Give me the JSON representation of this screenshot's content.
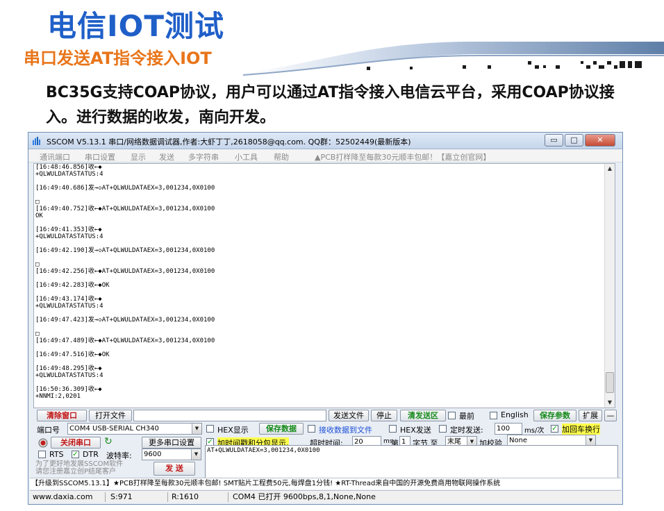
{
  "slide": {
    "title": "电信IOT测试",
    "subtitle": "串口发送AT指令接入IOT",
    "body": "BC35G支持COAP协议，用户可以通过AT指令接入电信云平台，采用COAP协议接入。进行数据的收发，南向开发。"
  },
  "window": {
    "title": "SSCOM V5.13.1 串口/网络数据调试器,作者:大虾丁丁,2618058@qq.com. QQ群：52502449(最新版本)",
    "controls": {
      "minimize": "▭",
      "maximize": "□",
      "close": "✕"
    }
  },
  "menu": {
    "items": [
      "通讯端口",
      "串口设置",
      "显示",
      "发送",
      "多字符串",
      "小工具",
      "帮助"
    ],
    "ad": "▲PCB打样降至每款30元顺丰包邮！【嘉立创官网】"
  },
  "log": {
    "lines": [
      "[16:48:46.856]收←◆",
      "+QLWULDATASTATUS:4",
      "",
      "[16:49:40.686]发→◇AT+QLWULDATAEX=3,001234,0X0100",
      "",
      "□",
      "[16:49:40.752]收←◆AT+QLWULDATAEX=3,001234,0X0100",
      "OK",
      "",
      "[16:49:41.353]收←◆",
      "+QLWULDATASTATUS:4",
      "",
      "[16:49:42.190]发→◇AT+QLWULDATAEX=3,001234,0X0100",
      "",
      "□",
      "[16:49:42.256]收←◆AT+QLWULDATAEX=3,001234,0X0100",
      "",
      "[16:49:42.283]收←◆OK",
      "",
      "[16:49:43.174]收←◆",
      "+QLWULDATASTATUS:4",
      "",
      "[16:49:47.423]发→◇AT+QLWULDATAEX=3,001234,0X0100",
      "",
      "□",
      "[16:49:47.489]收←◆AT+QLWULDATAEX=3,001234,0X0100",
      "",
      "[16:49:47.516]收←◆OK",
      "",
      "[16:49:48.295]收←◆",
      "+QLWULDATASTATUS:4",
      "",
      "[16:50:36.309]收←◆",
      "+NNMI:2,0201"
    ]
  },
  "toolbar": {
    "clear_window": "清除窗口",
    "open_file": "打开文件",
    "send_file": "发送文件",
    "stop": "停止",
    "clear_send": "清发送区",
    "topmost": "最前",
    "english": "English",
    "save_params": "保存参数",
    "expand": "扩展",
    "collapse": "—"
  },
  "port": {
    "label": "端口号",
    "value": "COM4 USB-SERIAL CH340",
    "close_port": "关闭串口",
    "more_settings": "更多串口设置",
    "rts": "RTS",
    "dtr": "DTR",
    "baud_label": "波特率:",
    "baud_value": "9600"
  },
  "options": {
    "hex_display": "HEX显示",
    "save_data": "保存数据",
    "recv_to_file": "接收数据到文件",
    "hex_send": "HEX发送",
    "timed_send": "定时发送:",
    "interval_value": "100",
    "interval_unit": "ms/次",
    "append_newline": "加回车换行",
    "timestamp": "加时间戳和分包显示,",
    "timeout_label": "超时时间:",
    "timeout_value": "20",
    "timeout_unit": "ms",
    "byte_prefix": "第",
    "byte_index": "1",
    "byte_suffix": "字节 至",
    "byte_end": "末尾",
    "checksum_label": "加校验",
    "checksum_value": "None"
  },
  "send": {
    "text": "AT+QLWULDATAEX=3,001234,0X0100",
    "button": "发 送",
    "promo": "为了更好地发展SSCOM软件\n请您注册嘉立创P结尾客户"
  },
  "adbar": "【升级到SSCOM5.13.1】★PCB打样降至每款30元顺丰包邮! SMT贴片工程费50元,每焊盘1分钱! ★RT-Thread来自中国的开源免费商用物联网操作系统",
  "status": {
    "site": "www.daxia.com",
    "sent": "S:971",
    "received": "R:1610",
    "port_status": "COM4 已打开  9600bps,8,1,None,None"
  }
}
